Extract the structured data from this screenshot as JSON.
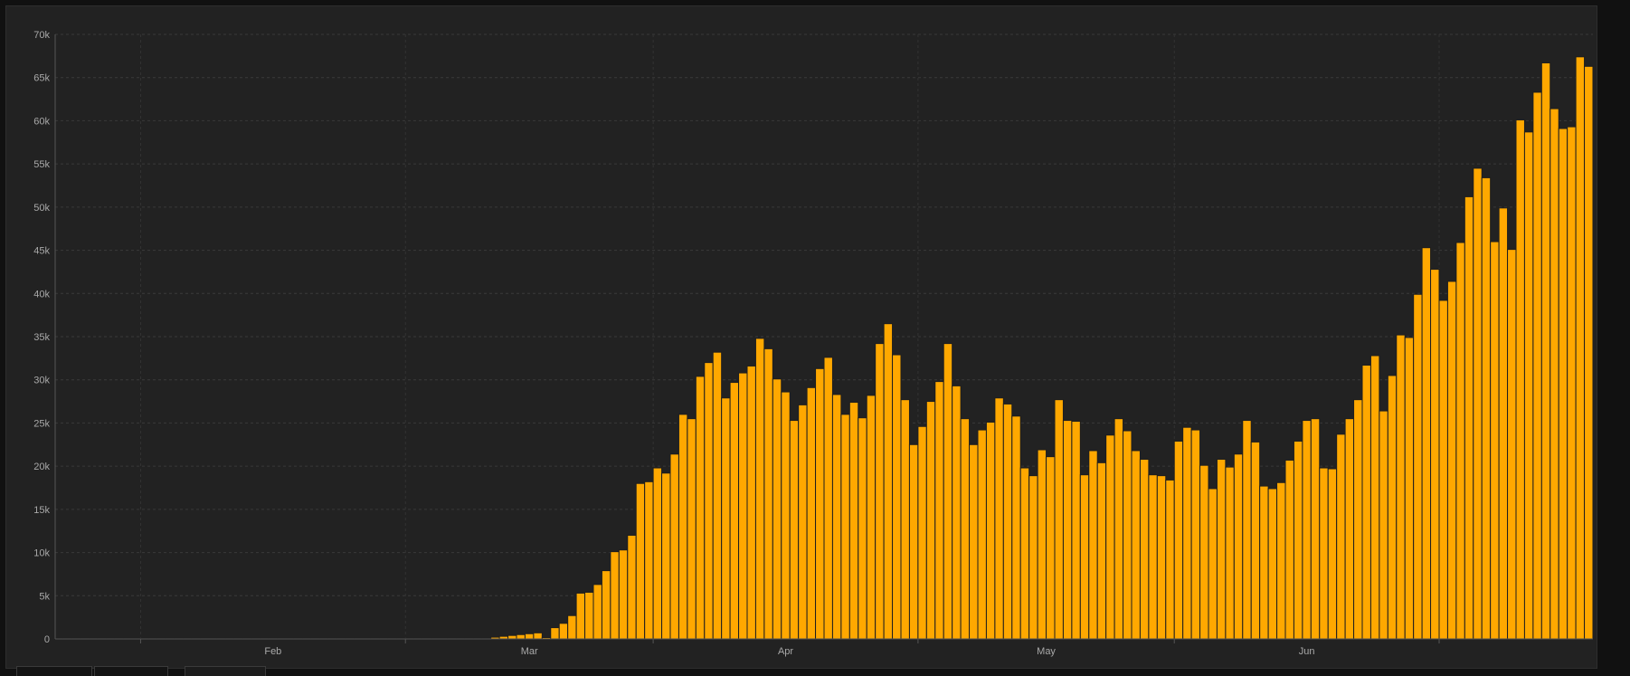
{
  "chart_data": {
    "type": "bar",
    "bar_color": "#FFA800",
    "background": "#222222",
    "grid": true,
    "ylim": [
      0,
      70000
    ],
    "y_ticks": [
      {
        "value": 0,
        "label": "0"
      },
      {
        "value": 5000,
        "label": "5k"
      },
      {
        "value": 10000,
        "label": "10k"
      },
      {
        "value": 15000,
        "label": "15k"
      },
      {
        "value": 20000,
        "label": "20k"
      },
      {
        "value": 25000,
        "label": "25k"
      },
      {
        "value": 30000,
        "label": "30k"
      },
      {
        "value": 35000,
        "label": "35k"
      },
      {
        "value": 40000,
        "label": "40k"
      },
      {
        "value": 45000,
        "label": "45k"
      },
      {
        "value": 50000,
        "label": "50k"
      },
      {
        "value": 55000,
        "label": "55k"
      },
      {
        "value": 60000,
        "label": "60k"
      },
      {
        "value": 65000,
        "label": "65k"
      },
      {
        "value": 70000,
        "label": "70k"
      }
    ],
    "x_labels": [
      "Feb",
      "Mar",
      "Apr",
      "May",
      "Jun"
    ],
    "values": [
      0,
      0,
      0,
      0,
      0,
      0,
      0,
      0,
      0,
      0,
      0,
      0,
      0,
      0,
      0,
      0,
      0,
      0,
      0,
      0,
      0,
      0,
      0,
      0,
      0,
      0,
      0,
      0,
      0,
      0,
      0,
      0,
      0,
      0,
      0,
      0,
      0,
      0,
      0,
      0,
      0,
      0,
      0,
      0,
      0,
      0,
      100,
      0,
      100,
      100,
      100,
      200,
      300,
      400,
      500,
      600,
      700,
      150,
      1300,
      1800,
      2700,
      5300,
      5400,
      6300,
      7900,
      10100,
      10300,
      12000,
      18000,
      18200,
      19800,
      19200,
      21400,
      26000,
      25500,
      30400,
      32000,
      33200,
      27900,
      29700,
      30800,
      31600,
      34800,
      33600,
      30100,
      28600,
      25300,
      27100,
      29100,
      31300,
      32600,
      28300,
      26000,
      27400,
      25600,
      28200,
      34200,
      36500,
      32900,
      27700,
      22500,
      24600,
      27500,
      29800,
      34200,
      29300,
      25500,
      22500,
      24200,
      25100,
      27900,
      27200,
      25800,
      19800,
      18900,
      21900,
      21100,
      27700,
      25300,
      25200,
      19000,
      21800,
      20400,
      23600,
      25500,
      24100,
      21800,
      20800,
      19000,
      18900,
      18400,
      22900,
      24500,
      24200,
      20100,
      17400,
      20800,
      19900,
      21400,
      25300,
      22800,
      17700,
      17400,
      18100,
      20700,
      22900,
      25300,
      25500,
      19800,
      19700,
      23700,
      25500,
      27700,
      31700,
      32800,
      26400,
      30500,
      35200,
      34900,
      39900,
      45300,
      42800,
      39200,
      41400,
      45900,
      51200,
      54500,
      53400,
      46000,
      49900,
      45100,
      60100,
      58700,
      63300,
      66700,
      61400,
      59100,
      59300,
      67400,
      66300
    ]
  }
}
